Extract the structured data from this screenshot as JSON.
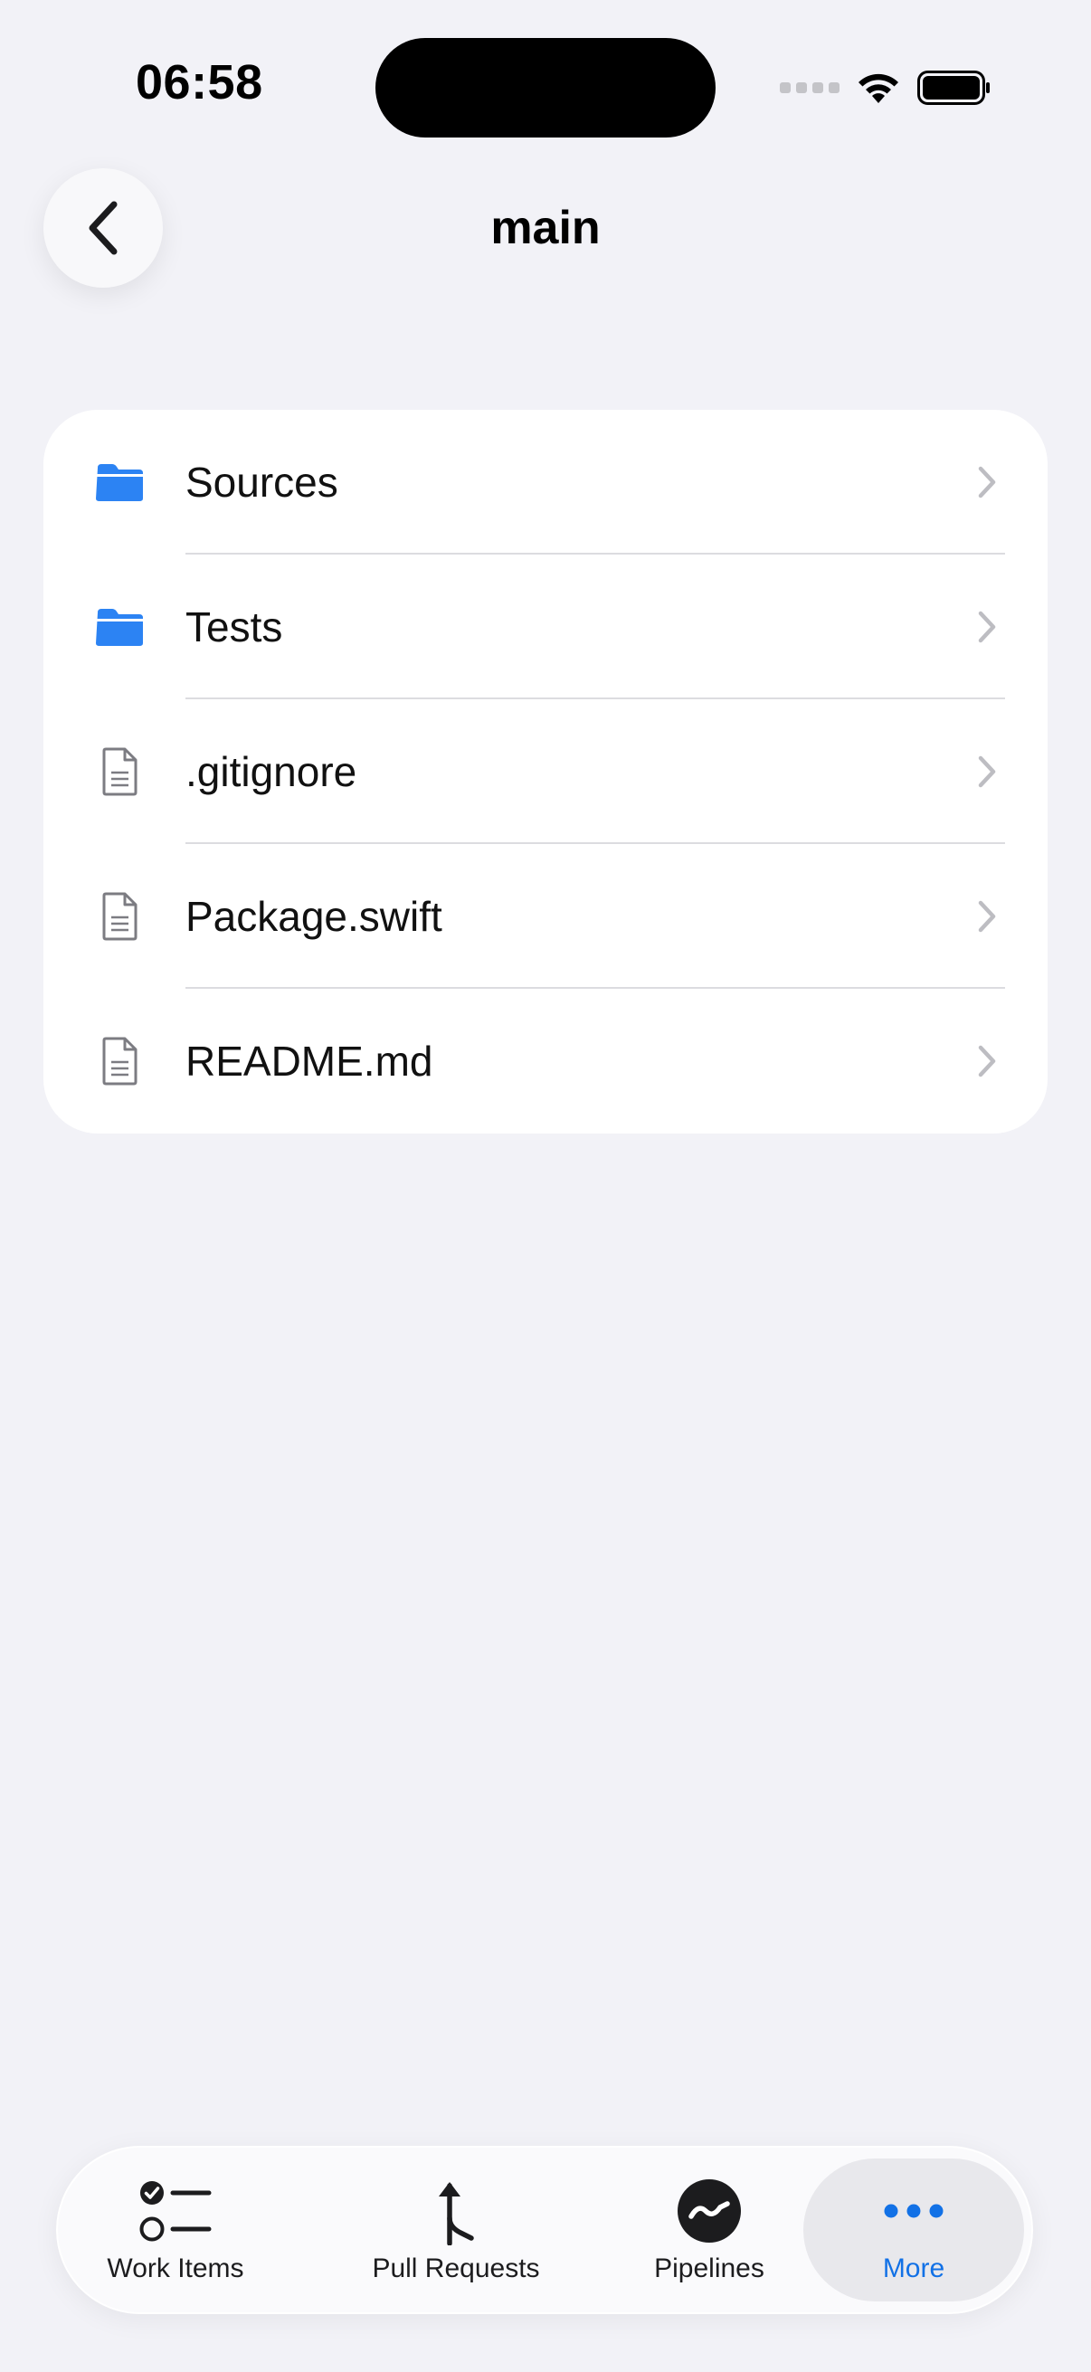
{
  "status_bar": {
    "time": "06:58"
  },
  "nav": {
    "title": "main"
  },
  "files": [
    {
      "name": "Sources",
      "kind": "folder"
    },
    {
      "name": "Tests",
      "kind": "folder"
    },
    {
      "name": ".gitignore",
      "kind": "file"
    },
    {
      "name": "Package.swift",
      "kind": "file"
    },
    {
      "name": "README.md",
      "kind": "file"
    }
  ],
  "tabs": [
    {
      "label": "Work Items",
      "icon": "checklist-icon"
    },
    {
      "label": "Pull Requests",
      "icon": "merge-icon"
    },
    {
      "label": "Pipelines",
      "icon": "pipeline-icon"
    },
    {
      "label": "More",
      "icon": "more-icon",
      "active": true
    }
  ],
  "colors": {
    "accent": "#1271e6",
    "folder": "#2c83f3",
    "background": "#f2f2f7"
  }
}
